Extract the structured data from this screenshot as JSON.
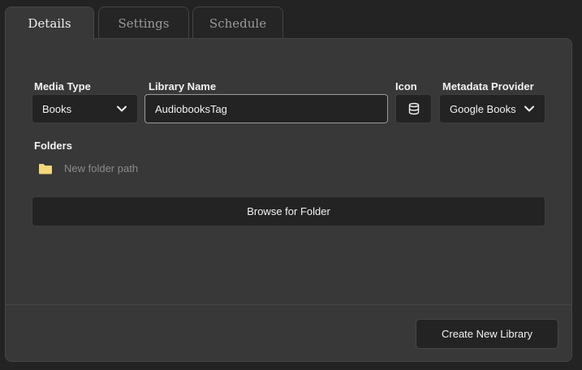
{
  "tabs": [
    {
      "label": "Details",
      "active": true
    },
    {
      "label": "Settings",
      "active": false
    },
    {
      "label": "Schedule",
      "active": false
    }
  ],
  "form": {
    "media_type": {
      "label": "Media Type",
      "value": "Books",
      "icon": "chevron-down-icon"
    },
    "library_name": {
      "label": "Library Name",
      "value": "AudiobooksTag"
    },
    "icon": {
      "label": "Icon",
      "value": "database-icon"
    },
    "metadata_provider": {
      "label": "Metadata Provider",
      "value": "Google Books",
      "icon": "chevron-down-icon"
    }
  },
  "folders": {
    "label": "Folders",
    "new_path_placeholder": "New folder path",
    "folder_icon_color": "#f4d77a"
  },
  "actions": {
    "browse_label": "Browse for Folder",
    "create_label": "Create New Library"
  }
}
